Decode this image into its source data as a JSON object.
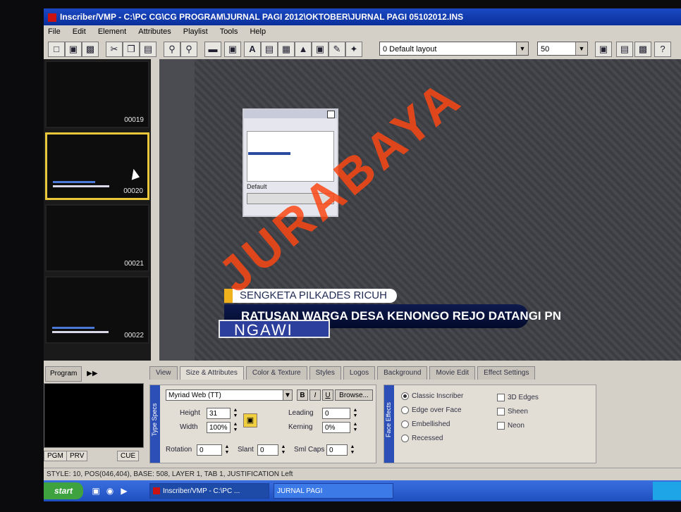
{
  "window": {
    "title": "Inscriber/VMP - C:\\PC CG\\CG PROGRAM\\JURNAL PAGI 2012\\OKTOBER\\JURNAL PAGI 05102012.INS"
  },
  "menu": [
    "File",
    "Edit",
    "Element",
    "Attributes",
    "Playlist",
    "Tools",
    "Help"
  ],
  "toolbar": {
    "layout_select": "0 Default layout",
    "zoom_select": "50",
    "text_tool_glyph": "A"
  },
  "thumbnails": [
    {
      "number": "00019"
    },
    {
      "number": "00020"
    },
    {
      "number": "00021"
    },
    {
      "number": "00022"
    }
  ],
  "mini_window": {
    "label": "Default"
  },
  "lower_third": {
    "headline": "SENGKETA PILKADES RICUH",
    "subhead": "RATUSAN WARGA DESA KENONGO REJO DATANGI PN",
    "location": "NGAWI"
  },
  "left_panel": {
    "program_label": "Program",
    "pgm": "PGM",
    "prv": "PRV",
    "cue": "CUE"
  },
  "tabs": [
    "View",
    "Size & Attributes",
    "Color & Texture",
    "Styles",
    "Logos",
    "Background",
    "Movie Edit",
    "Effect Settings"
  ],
  "type_specs": {
    "panel_label": "Type Specs",
    "font": "Myriad Web (TT)",
    "bold": "B",
    "italic": "I",
    "underline": "U",
    "browse": "Browse...",
    "height_label": "Height",
    "height_value": "31",
    "width_label": "Width",
    "width_value": "100%",
    "leading_label": "Leading",
    "leading_value": "0",
    "kerning_label": "Kerning",
    "kerning_value": "0%",
    "rotation_label": "Rotation",
    "rotation_value": "0",
    "slant_label": "Slant",
    "slant_value": "0",
    "smallcaps_label": "Sml Caps",
    "smallcaps_value": "0"
  },
  "effects": {
    "panel_label": "Face Effects",
    "classic": "Classic Inscriber",
    "edge_over_face": "Edge over Face",
    "embellished": "Embellished",
    "recessed": "Recessed",
    "edges_3d": "3D Edges",
    "sheen": "Sheen",
    "neon": "Neon"
  },
  "status": "STYLE: 10, POS(046,404), BASE: 508, LAYER 1, TAB 1, JUSTIFICATION Left",
  "taskbar": {
    "start": "start",
    "item1": "Inscriber/VMP - C:\\PC ...",
    "item2": "JURNAL PAGI"
  },
  "watermark": "JURABAYA"
}
